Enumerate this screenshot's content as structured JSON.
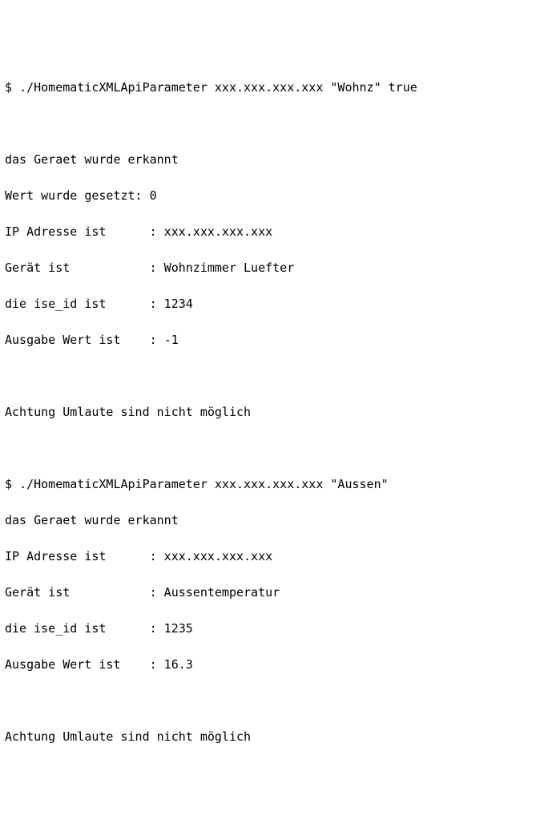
{
  "terminal": {
    "block1": {
      "prompt": "$ ",
      "command": "./HomematicXMLApiParameter xxx.xxx.xxx.xxx \"Wohnz\" true",
      "out_recognized": "das Geraet wurde erkannt",
      "out_set": "Wert wurde gesetzt: 0",
      "out_ip": "IP Adresse ist      : xxx.xxx.xxx.xxx",
      "out_device": "Gerät ist           : Wohnzimmer Luefter",
      "out_iseid": "die ise_id ist      : 1234",
      "out_value": "Ausgabe Wert ist    : -1",
      "out_warning": "Achtung Umlaute sind nicht möglich"
    },
    "block2": {
      "prompt": "$ ",
      "command": "./HomematicXMLApiParameter xxx.xxx.xxx.xxx \"Aussen\"",
      "out_recognized": "das Geraet wurde erkannt",
      "out_ip": "IP Adresse ist      : xxx.xxx.xxx.xxx",
      "out_device": "Gerät ist           : Aussentemperatur",
      "out_iseid": "die ise_id ist      : 1235",
      "out_value": "Ausgabe Wert ist    : 16.3",
      "out_warning": "Achtung Umlaute sind nicht möglich"
    }
  }
}
